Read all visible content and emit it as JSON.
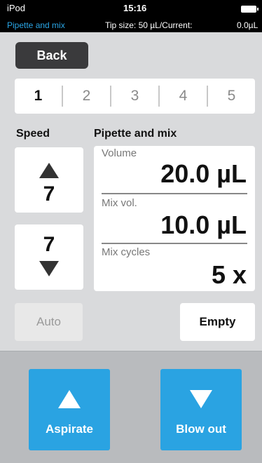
{
  "status_bar": {
    "carrier": "iPod",
    "time": "15:16",
    "mode": "Pipette and mix",
    "tip_size": "Tip size:  50 µL/Current:",
    "current": "0.0µL"
  },
  "nav": {
    "back_label": "Back"
  },
  "tabs": [
    "1",
    "2",
    "3",
    "4",
    "5"
  ],
  "speed": {
    "label": "Speed",
    "aspirate_value": "7",
    "dispense_value": "7"
  },
  "pipette_mix": {
    "label": "Pipette and mix",
    "volume_label": "Volume",
    "volume_value": "20.0 µL",
    "mix_vol_label": "Mix vol.",
    "mix_vol_value": "10.0 µL",
    "mix_cycles_label": "Mix cycles",
    "mix_cycles_value": "5 x"
  },
  "controls": {
    "auto_label": "Auto",
    "empty_label": "Empty",
    "aspirate_label": "Aspirate",
    "blowout_label": "Blow out"
  },
  "colors": {
    "accent": "#2aa3e2",
    "background": "#d9dadc",
    "dark_button": "#3a3a3c"
  }
}
